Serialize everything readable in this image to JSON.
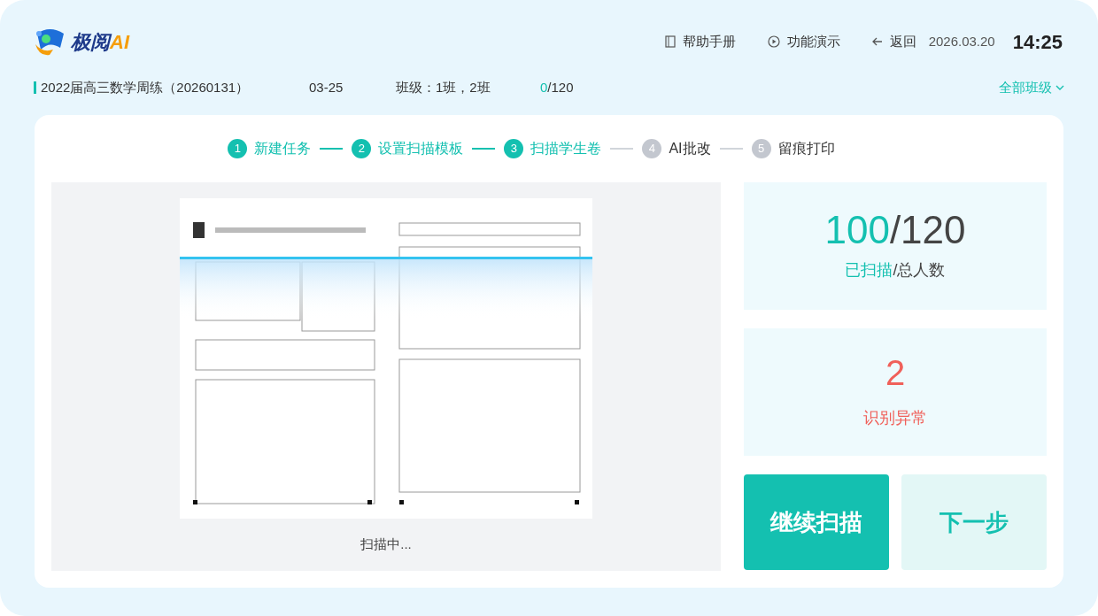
{
  "header": {
    "logo": {
      "name": "极阅",
      "suffix": "AI"
    },
    "links": [
      {
        "kind": "help",
        "label": "帮助手册"
      },
      {
        "kind": "demo",
        "label": "功能演示"
      },
      {
        "kind": "back",
        "label": "返回"
      }
    ],
    "date": "2026.03.20",
    "time": "14:25"
  },
  "task": {
    "title": "2022届高三数学周练（20260131）",
    "date": "03-25",
    "classes": "班级：1班，2班",
    "progress_done": "0",
    "progress_total": "/120",
    "filter": "全部班级"
  },
  "steps": [
    {
      "number": "1",
      "label": "新建任务",
      "active": true
    },
    {
      "number": "2",
      "label": "设置扫描模板",
      "active": true
    },
    {
      "number": "3",
      "label": "扫描学生卷",
      "active": true
    },
    {
      "number": "4",
      "label": "AI批改",
      "active": false
    },
    {
      "number": "5",
      "label": "留痕打印",
      "active": false
    }
  ],
  "scan": {
    "caption": "扫描中..."
  },
  "scanned": {
    "value": "100",
    "total": "/120",
    "label": "已扫描",
    "label_total": "/总人数"
  },
  "anomalies": {
    "value": "2",
    "label": "识别异常"
  },
  "buttons": [
    {
      "kind": "primary",
      "label": "继续扫描"
    },
    {
      "kind": "secondary",
      "label": "下一步"
    }
  ]
}
